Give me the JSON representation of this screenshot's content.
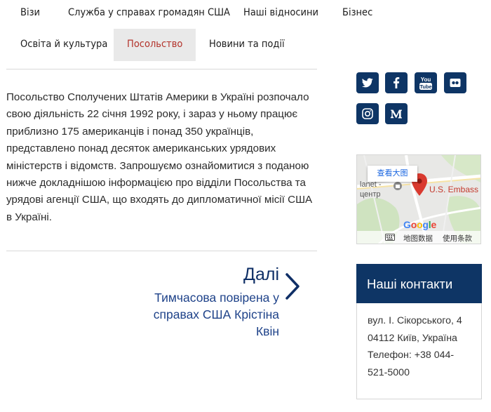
{
  "nav": {
    "visas": "Візи",
    "citizen_services": "Служба у справах громадян США",
    "relations": "Наші відносини",
    "business": "Бізнес",
    "education": "Освіта й культура",
    "embassy": "Посольство",
    "news": "Новини та події"
  },
  "article": {
    "body": "Посольство Сполучених Штатів Америки в Україні розпочало свою діяльність 22 січня 1992 року, і зараз у ньому працює приблизно 175 американців і понад 350 українців, представлено понад десяток американських урядових міністерств і відомств. Запрошуємо ознайомитися з поданою нижче докладнішою інформацією про відділи Посольства та урядові агенції США, що входять до дипломатичної місії США в Україні."
  },
  "next": {
    "label": "Далі",
    "title": "Тимчасова повірена у справах США Крістіна Квін"
  },
  "social": {
    "icons": [
      "twitter-icon",
      "facebook-icon",
      "youtube-icon",
      "flickr-icon",
      "instagram-icon",
      "medium-icon"
    ],
    "youtube_text": "You Tube"
  },
  "map": {
    "view_larger": "查看大图",
    "embassy_label": "U.S. Embass",
    "area_label_1": "lanet -",
    "area_label_2": "центр",
    "google": [
      "G",
      "o",
      "o",
      "g",
      "l",
      "e"
    ],
    "map_data": "地图数据",
    "terms": "使用条款"
  },
  "contacts": {
    "title": "Наші контакти",
    "address": "вул. І. Сікорського, 4",
    "city": "04112 Київ, Україна",
    "phone_1": "Телефон: +38 044-",
    "phone_2": "521-5000"
  },
  "colors": {
    "brand_navy": "#0e3565",
    "link_blue": "#1e4289",
    "active_red": "#b3332b"
  }
}
